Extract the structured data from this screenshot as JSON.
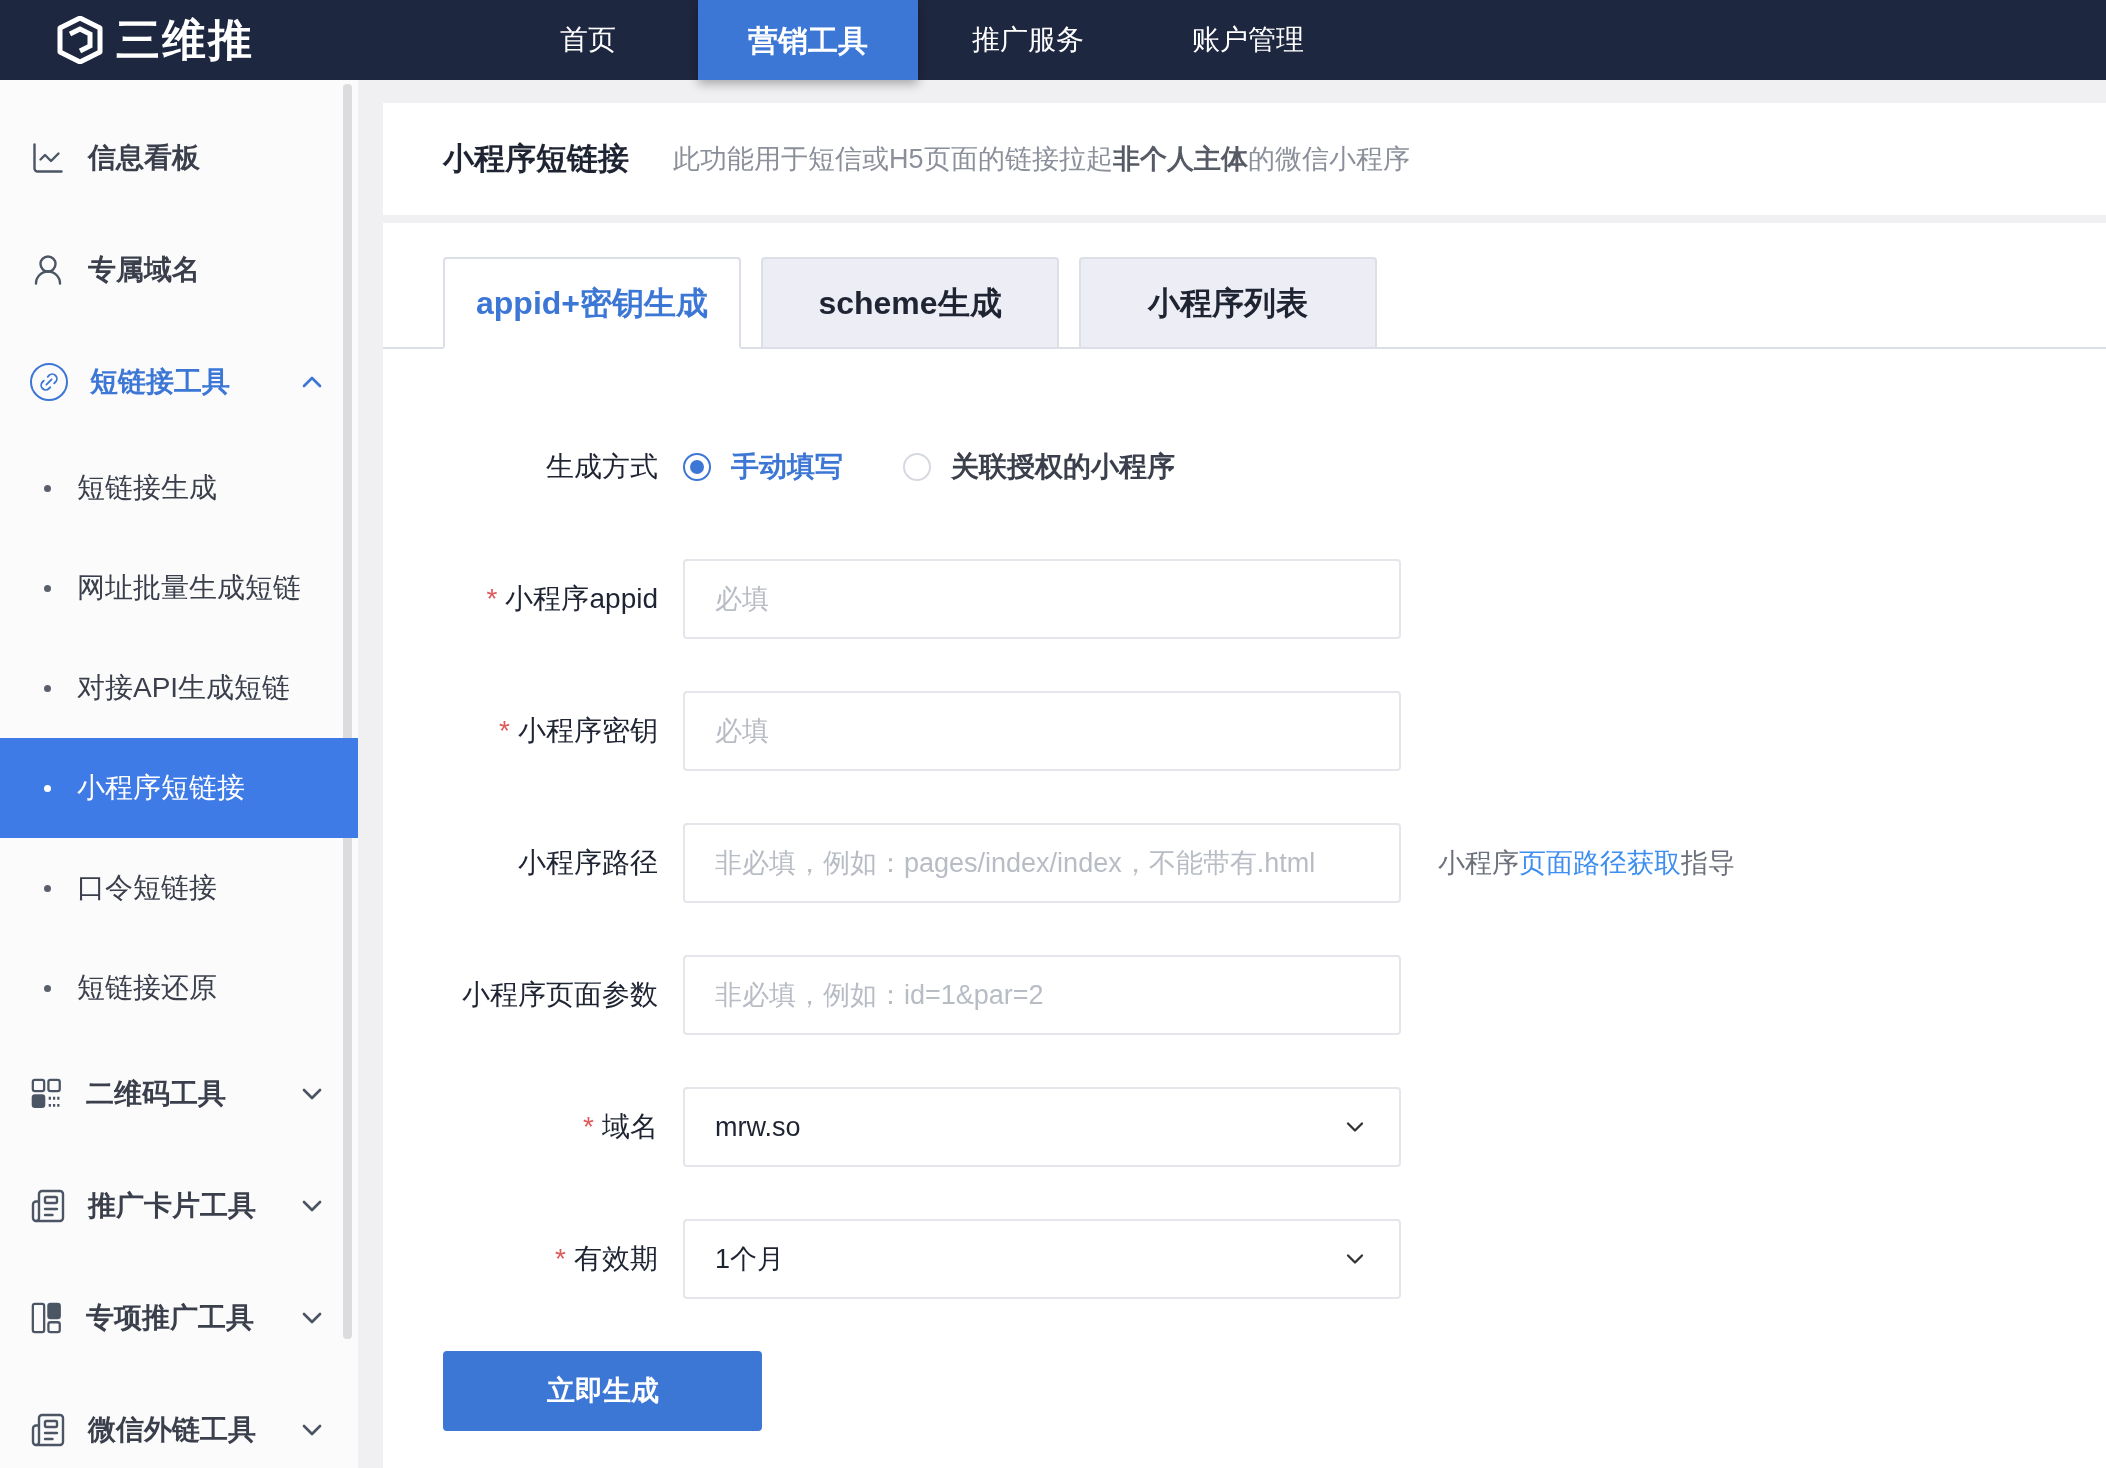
{
  "header": {
    "logo": "三维推",
    "nav": [
      {
        "label": "首页",
        "selected": false
      },
      {
        "label": "营销工具",
        "selected": true
      },
      {
        "label": "推广服务",
        "selected": false
      },
      {
        "label": "账户管理",
        "selected": false
      }
    ]
  },
  "sidebar": {
    "items": [
      {
        "label": "信息看板",
        "kind": "link"
      },
      {
        "label": "专属域名",
        "kind": "link"
      },
      {
        "label": "短链接工具",
        "kind": "group",
        "expanded": true,
        "children": [
          {
            "label": "短链接生成",
            "selected": false
          },
          {
            "label": "网址批量生成短链",
            "selected": false
          },
          {
            "label": "对接API生成短链",
            "selected": false
          },
          {
            "label": "小程序短链接",
            "selected": true
          },
          {
            "label": "口令短链接",
            "selected": false
          },
          {
            "label": "短链接还原",
            "selected": false
          }
        ]
      },
      {
        "label": "二维码工具",
        "kind": "group",
        "expanded": false
      },
      {
        "label": "推广卡片工具",
        "kind": "group",
        "expanded": false
      },
      {
        "label": "专项推广工具",
        "kind": "group",
        "expanded": false
      },
      {
        "label": "微信外链工具",
        "kind": "group",
        "expanded": false
      }
    ]
  },
  "page": {
    "title": "小程序短链接",
    "description": "此功能用于短信或H5页面的链接拉起**非个人主体**的微信小程序"
  },
  "tabs": [
    {
      "label": "appid+密钥生成",
      "selected": true
    },
    {
      "label": "scheme生成",
      "selected": false
    },
    {
      "label": "小程序列表",
      "selected": false
    }
  ],
  "form": {
    "method": {
      "label": "生成方式",
      "options": [
        {
          "label": "手动填写",
          "selected": true
        },
        {
          "label": "关联授权的小程序",
          "selected": false
        }
      ]
    },
    "fields": [
      {
        "label": "小程序appid",
        "required": true,
        "kind": "input",
        "placeholder": "必填"
      },
      {
        "label": "小程序密钥",
        "required": true,
        "kind": "input",
        "placeholder": "必填"
      },
      {
        "label": "小程序路径",
        "required": false,
        "kind": "input",
        "placeholder": "非必填，例如：pages/index/index，不能带有.html",
        "help": {
          "prefix": "小程序",
          "link": "页面路径获取",
          "suffix": "指导"
        }
      },
      {
        "label": "小程序页面参数",
        "required": false,
        "kind": "input",
        "placeholder": "非必填，例如：id=1&par=2"
      },
      {
        "label": "域名",
        "required": true,
        "kind": "select",
        "value": "mrw.so"
      },
      {
        "label": "有效期",
        "required": true,
        "kind": "select",
        "value": "1个月"
      }
    ],
    "required_mark": "*",
    "submit": "立即生成"
  }
}
